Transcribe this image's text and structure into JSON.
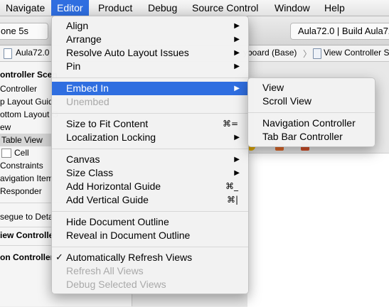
{
  "menubar": {
    "items": [
      "Navigate",
      "Editor",
      "Product",
      "Debug",
      "Source Control",
      "Window",
      "Help"
    ]
  },
  "toolbar": {
    "scheme_fragment": "one 5s",
    "status_fragment": "Aula72.0  |  Build Aula72"
  },
  "jumpbar": {
    "project": "Aula72.0",
    "storyboard": "yboard (Base)",
    "scene": "View Controller Sc"
  },
  "outline": {
    "rows": [
      "ontroller Scen",
      "Controller",
      "p Layout Guid",
      "ottom Layout G",
      "ew",
      "Table View",
      "Cell",
      "Constraints",
      "avigation Item",
      "Responder",
      "segue to Deta",
      "iew Controlle",
      "on Controller"
    ]
  },
  "editor_menu": {
    "align": "Align",
    "arrange": "Arrange",
    "resolve": "Resolve Auto Layout Issues",
    "pin": "Pin",
    "embed_in": "Embed In",
    "unembed": "Unembed",
    "size_to_fit": "Size to Fit Content",
    "size_to_fit_shortcut": "⌘=",
    "localization_locking": "Localization Locking",
    "canvas": "Canvas",
    "size_class": "Size Class",
    "add_h_guide": "Add Horizontal Guide",
    "add_h_guide_shortcut": "⌘_",
    "add_v_guide": "Add Vertical Guide",
    "add_v_guide_shortcut": "⌘|",
    "hide_outline": "Hide Document Outline",
    "reveal_outline": "Reveal in Document Outline",
    "auto_refresh": "Automatically Refresh Views",
    "auto_refresh_check": "✓",
    "refresh_all": "Refresh All Views",
    "debug_selected": "Debug Selected Views",
    "submenu_arrow": "▶"
  },
  "embed_submenu": {
    "view": "View",
    "scroll_view": "Scroll View",
    "navigation_controller": "Navigation Controller",
    "tab_bar_controller": "Tab Bar Controller"
  },
  "colors": {
    "highlight": "#2f6ee0",
    "dock_yellow": "#f0b400",
    "dock_orange": "#e06a2c",
    "dock_red": "#d4502a"
  },
  "icons": [
    "document-icon",
    "table-cell-icon",
    "view-controller-icon",
    "first-responder-icon",
    "exit-icon"
  ]
}
